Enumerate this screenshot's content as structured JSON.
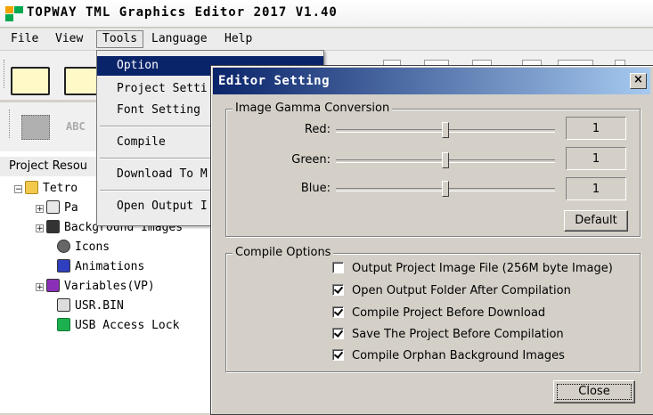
{
  "app": {
    "title": "TOPWAY TML Graphics Editor 2017 V1.40"
  },
  "menubar": {
    "items": [
      "File",
      "View",
      "Tools",
      "Language",
      "Help"
    ]
  },
  "tools_menu": {
    "items": [
      "Option",
      "Project Setti",
      "Font Setting",
      "Compile",
      "Download To M",
      "Open Output I"
    ],
    "highlighted": "Option"
  },
  "toolbar": {
    "element_label": "ABC"
  },
  "project_panel": {
    "header": "Project Resou",
    "root": "Tetro",
    "items": [
      "Pa",
      "Background Images",
      "Icons",
      "Animations",
      "Variables(VP)",
      "USR.BIN",
      "USB Access Lock"
    ]
  },
  "dialog": {
    "title": "Editor Setting",
    "close_glyph": "×",
    "gamma": {
      "group_title": "Image Gamma Conversion",
      "channels": [
        {
          "label": "Red:",
          "value": "1"
        },
        {
          "label": "Green:",
          "value": "1"
        },
        {
          "label": "Blue:",
          "value": "1"
        }
      ],
      "slider_level": 0.5,
      "default_button": "Default"
    },
    "compile": {
      "group_title": "Compile Options",
      "options": [
        {
          "label": "Output Project Image File (256M byte Image)",
          "checked": false
        },
        {
          "label": "Open Output Folder After Compilation",
          "checked": true
        },
        {
          "label": "Compile Project Before Download",
          "checked": true
        },
        {
          "label": "Save The Project Before Compilation",
          "checked": true
        },
        {
          "label": "Compile Orphan Background Images",
          "checked": true
        }
      ]
    },
    "close_button": "Close"
  },
  "colors": {
    "selection": "#0a246a",
    "dialog_title_start": "#0a246a",
    "dialog_title_end": "#a6caf0"
  }
}
